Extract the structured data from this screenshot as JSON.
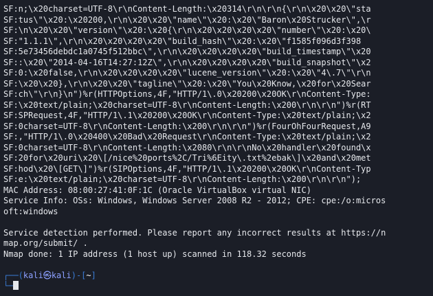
{
  "terminal": {
    "output_lines": [
      "SF:n;\\x20charset=UTF-8\\r\\nContent-Length:\\x20314\\r\\n\\r\\n{\\r\\n\\x20\\x20\\\"sta",
      "SF:tus\\\"\\x20:\\x20200,\\r\\n\\x20\\x20\\\"name\\\"\\x20:\\x20\\\"Baron\\x20Strucker\\\",\\r",
      "SF:\\n\\x20\\x20\\\"version\\\"\\x20:\\x20{\\r\\n\\x20\\x20\\x20\\x20\\\"number\\\"\\x20:\\x20\\",
      "SF:\"1.1.1\\\",\\r\\n\\x20\\x20\\x20\\x20\\\"build_hash\\\"\\x20:\\x20\\\"f1585f096d3f398",
      "SF:5e73456debdc1a0745f512bbc\\\",\\r\\n\\x20\\x20\\x20\\x20\\\"build_timestamp\\\"\\x20",
      "SF::\\x20\\\"2014-04-16T14:27:12Z\\\",\\r\\n\\x20\\x20\\x20\\x20\\\"build_snapshot\\\"\\x2",
      "SF:0:\\x20false,\\r\\n\\x20\\x20\\x20\\x20\\\"lucene_version\\\"\\x20:\\x20\\\"4\\.7\\\"\\r\\n",
      "SF:\\x20\\x20},\\r\\n\\x20\\x20\\\"tagline\\\"\\x20:\\x20\\\"You\\x20Know,\\x20for\\x20Sear",
      "SF:ch\\\"\\r\\n}\\n\")%r(HTTPOptions,4F,\"HTTP/1\\.0\\x20200\\x20OK\\r\\nContent-Type:",
      "SF:\\x20text/plain;\\x20charset=UTF-8\\r\\nContent-Length:\\x200\\r\\n\\r\\n\")%r(RT",
      "SF:SPRequest,4F,\"HTTP/1\\.1\\x20200\\x20OK\\r\\nContent-Type:\\x20text/plain;\\x2",
      "SF:0charset=UTF-8\\r\\nContent-Length:\\x200\\r\\n\\r\\n\")%r(FourOhFourRequest,A9",
      "SF:,\"HTTP/1\\.0\\x20400\\x20Bad\\x20Request\\r\\nContent-Type:\\x20text/plain;\\x2",
      "SF:0charset=UTF-8\\r\\nContent-Length:\\x2080\\r\\n\\r\\nNo\\x20handler\\x20found\\x",
      "SF:20for\\x20uri\\x20\\[/nice%20ports%2C/Tri%6Eity\\.txt%2ebak\\]\\x20and\\x20met",
      "SF:hod\\x20\\[GET\\]\")%r(SIPOptions,4F,\"HTTP/1\\.1\\x20200\\x20OK\\r\\nContent-Typ",
      "SF:e:\\x20text/plain;\\x20charset=UTF-8\\r\\nContent-Length:\\x200\\r\\n\\r\\n\");",
      "MAC Address: 08:00:27:41:0F:1C (Oracle VirtualBox virtual NIC)",
      "Service Info: OSs: Windows, Windows Server 2008 R2 - 2012; CPE: cpe:/o:micros",
      "oft:windows",
      "",
      "Service detection performed. Please report any incorrect results at https://n",
      "map.org/submit/ .",
      "Nmap done: 1 IP address (1 host up) scanned in 118.32 seconds"
    ],
    "prompt": {
      "corner_top": "┌──(",
      "user": "kali",
      "at": "㉿",
      "host": "kali",
      "mid": ")-[",
      "cwd": "~",
      "end": "]",
      "corner_bottom": "└─"
    }
  }
}
